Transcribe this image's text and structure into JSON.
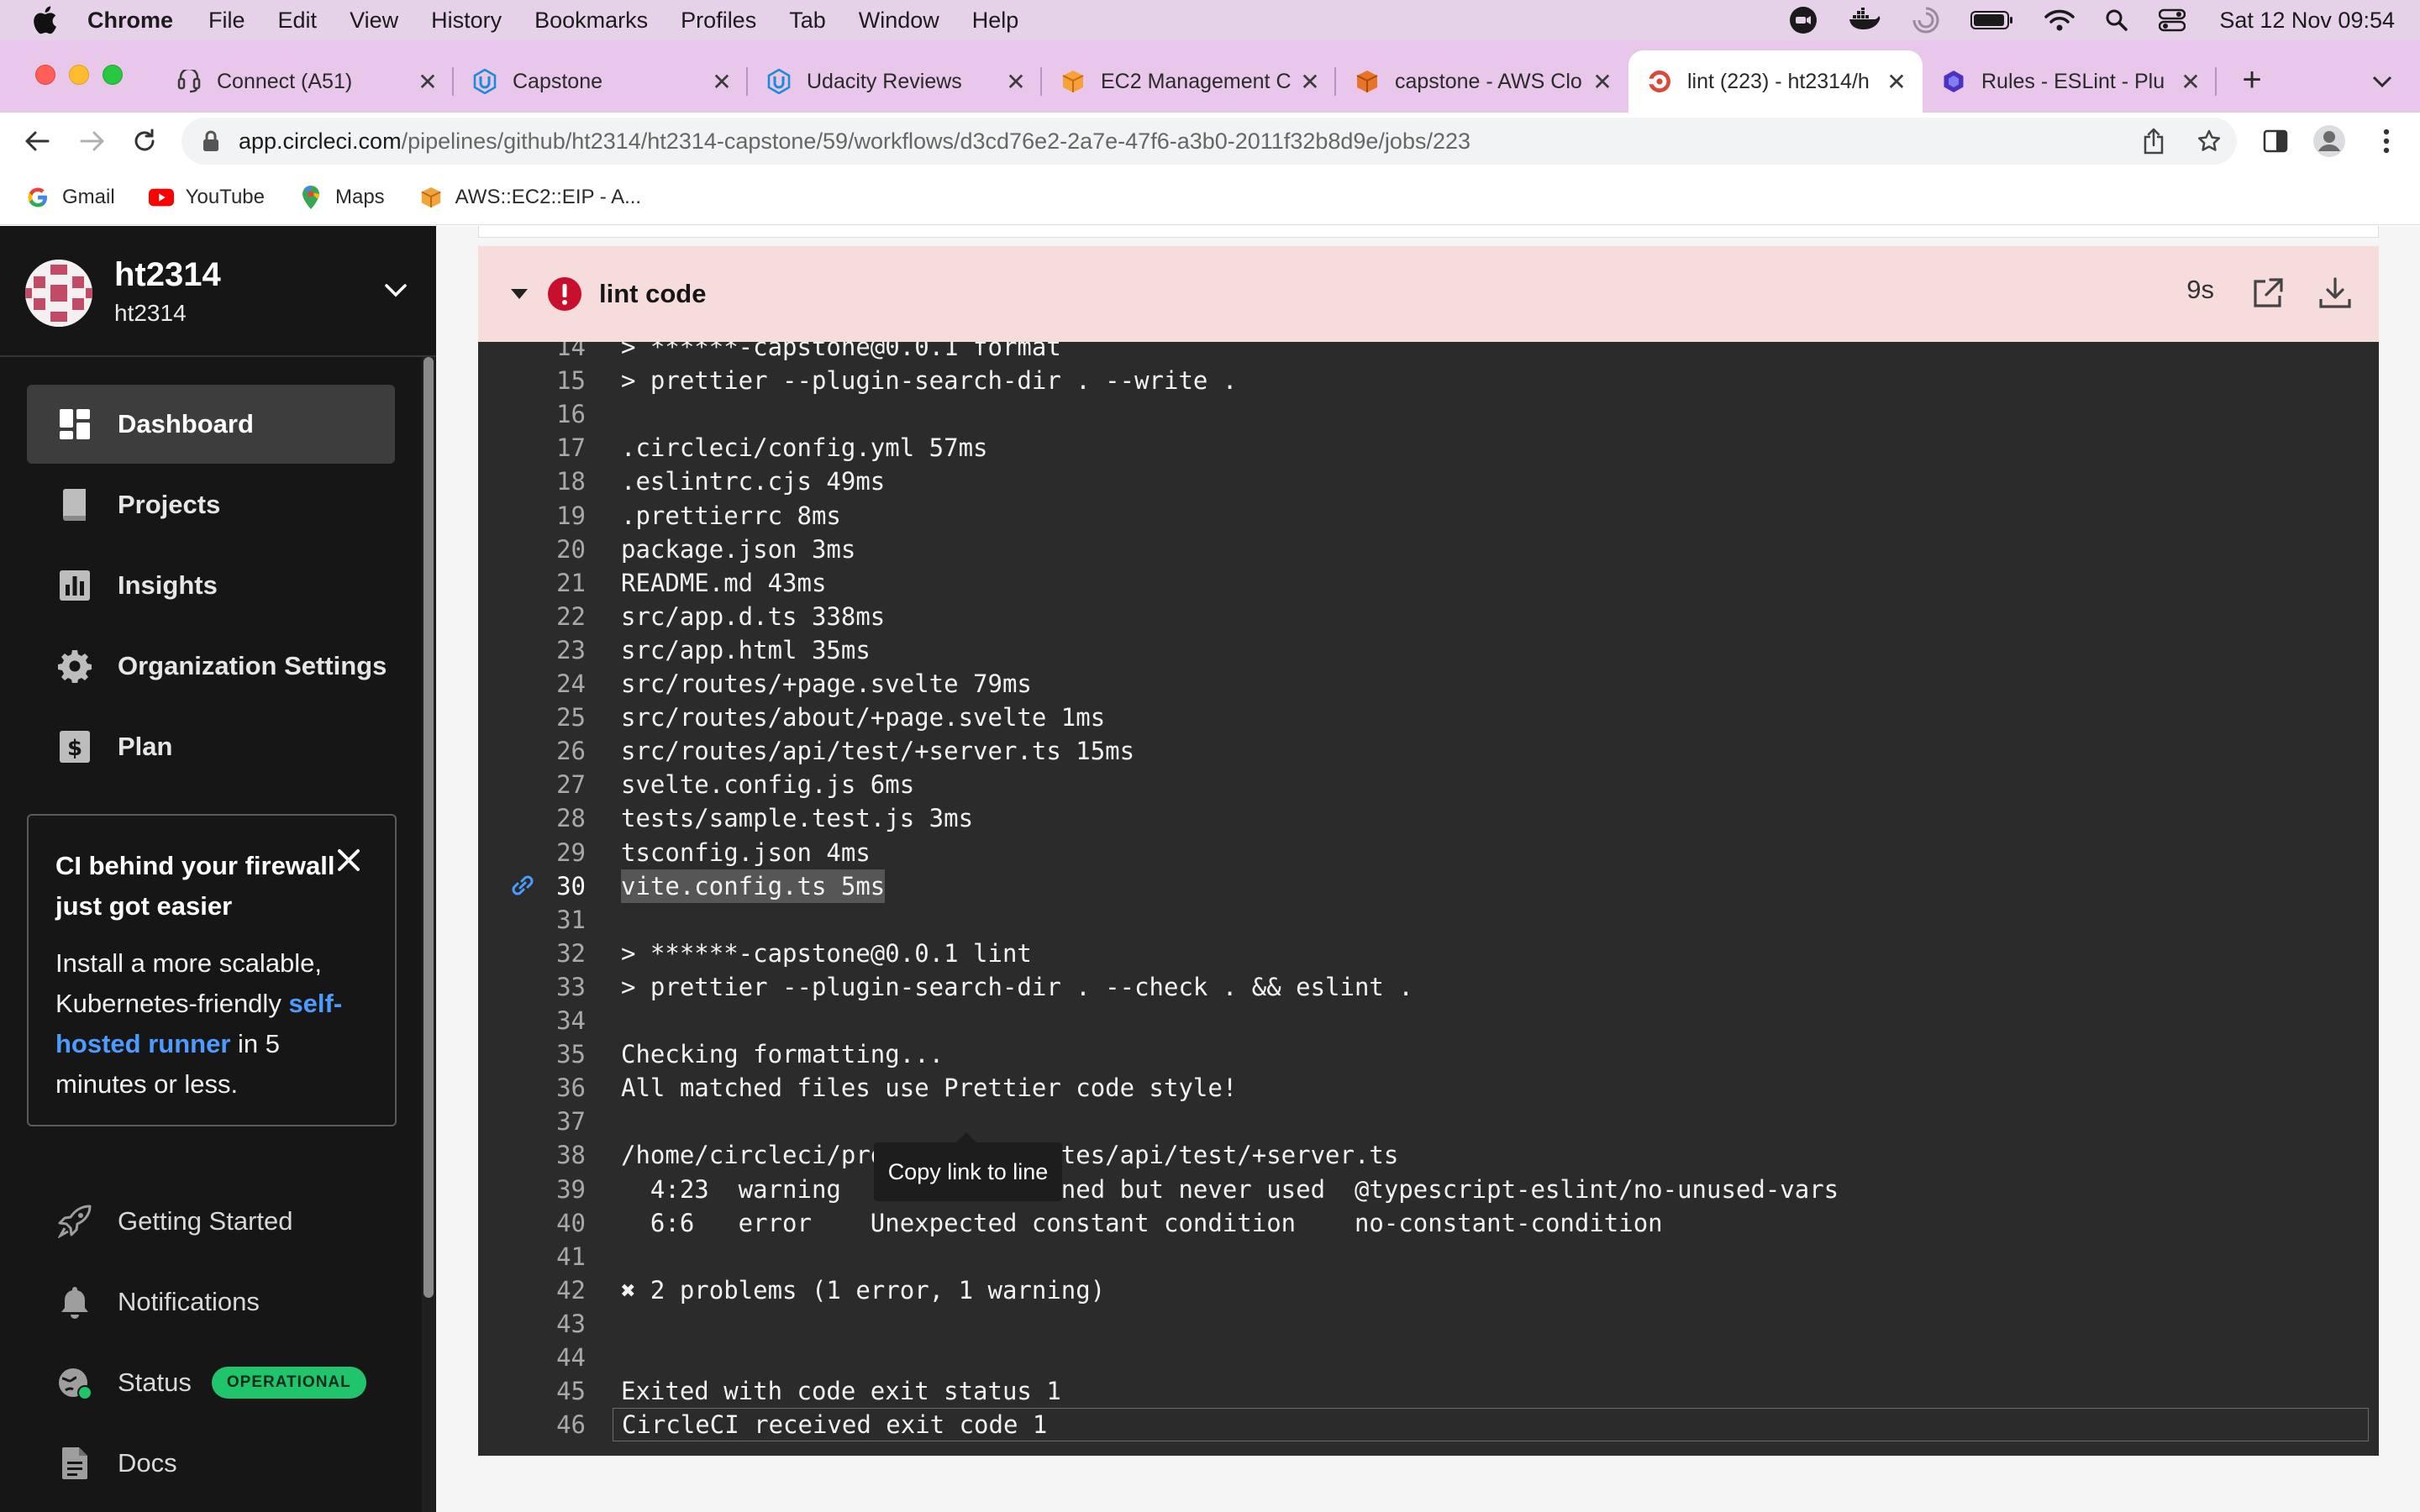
{
  "menubar": {
    "app_name": "Chrome",
    "items": [
      "File",
      "Edit",
      "View",
      "History",
      "Bookmarks",
      "Profiles",
      "Tab",
      "Window",
      "Help"
    ],
    "clock": "Sat 12 Nov  09:54"
  },
  "tabs": [
    {
      "title": "Connect (A51)",
      "icon": "aws-connect-icon"
    },
    {
      "title": "Capstone",
      "icon": "udacity-icon"
    },
    {
      "title": "Udacity Reviews",
      "icon": "udacity-icon"
    },
    {
      "title": "EC2 Management C",
      "icon": "aws-box-icon"
    },
    {
      "title": "capstone - AWS Clo",
      "icon": "aws-box-icon"
    },
    {
      "title": "lint (223) - ht2314/h",
      "icon": "circleci-icon",
      "active": true
    },
    {
      "title": "Rules - ESLint - Plu",
      "icon": "eslint-icon"
    }
  ],
  "address": {
    "host": "app.circleci.com",
    "path": "/pipelines/github/ht2314/ht2314-capstone/59/workflows/d3cd76e2-2a7e-47f6-a3b0-2011f32b8d9e/jobs/223"
  },
  "bookmarks": [
    {
      "label": "Gmail",
      "icon": "google-icon"
    },
    {
      "label": "YouTube",
      "icon": "youtube-icon"
    },
    {
      "label": "Maps",
      "icon": "maps-icon"
    },
    {
      "label": "AWS::EC2::EIP - A...",
      "icon": "aws-box-icon"
    }
  ],
  "sidebar": {
    "org_name": "ht2314",
    "org_sub": "ht2314",
    "nav": [
      {
        "label": "Dashboard",
        "icon": "dashboard-icon",
        "active": true
      },
      {
        "label": "Projects",
        "icon": "projects-icon"
      },
      {
        "label": "Insights",
        "icon": "insights-icon"
      },
      {
        "label": "Organization Settings",
        "icon": "gear-icon"
      },
      {
        "label": "Plan",
        "icon": "dollar-icon"
      }
    ],
    "promo": {
      "title": "CI behind your firewall just got easier",
      "body_before": "Install a more scalable, Kubernetes-friendly ",
      "link": "self-hosted runner",
      "body_after": " in 5 minutes or less."
    },
    "lower_nav": [
      {
        "label": "Getting Started",
        "icon": "rocket-icon"
      },
      {
        "label": "Notifications",
        "icon": "bell-icon"
      },
      {
        "label": "Status",
        "icon": "status-icon",
        "badge": "OPERATIONAL"
      },
      {
        "label": "Docs",
        "icon": "docs-icon"
      }
    ]
  },
  "step": {
    "name": "lint code",
    "duration": "9s",
    "status_color": "#d0021b"
  },
  "log_lines": [
    {
      "n": "14",
      "t": "> ******-capstone@0.0.1 format"
    },
    {
      "n": "15",
      "t": "> prettier --plugin-search-dir . --write ."
    },
    {
      "n": "16",
      "t": ""
    },
    {
      "n": "17",
      "t": ".circleci/config.yml 57ms"
    },
    {
      "n": "18",
      "t": ".eslintrc.cjs 49ms"
    },
    {
      "n": "19",
      "t": ".prettierrc 8ms"
    },
    {
      "n": "20",
      "t": "package.json 3ms"
    },
    {
      "n": "21",
      "t": "README.md 43ms"
    },
    {
      "n": "22",
      "t": "src/app.d.ts 338ms"
    },
    {
      "n": "23",
      "t": "src/app.html 35ms"
    },
    {
      "n": "24",
      "t": "src/routes/+page.svelte 79ms"
    },
    {
      "n": "25",
      "t": "src/routes/about/+page.svelte 1ms"
    },
    {
      "n": "26",
      "t": "src/routes/api/test/+server.ts 15ms"
    },
    {
      "n": "27",
      "t": "svelte.config.js 6ms"
    },
    {
      "n": "28",
      "t": "tests/sample.test.js 3ms"
    },
    {
      "n": "29",
      "t": "tsconfig.json 4ms"
    },
    {
      "n": "30",
      "t": "vite.config.ts 5ms",
      "selected": true
    },
    {
      "n": "31",
      "t": ""
    },
    {
      "n": "32",
      "t": "> ******-capstone@0.0.1 lint"
    },
    {
      "n": "33",
      "t": "> prettier --plugin-search-dir . --check . && eslint ."
    },
    {
      "n": "34",
      "t": ""
    },
    {
      "n": "35",
      "t": "Checking formatting..."
    },
    {
      "n": "36",
      "t": "All matched files use Prettier code style!"
    },
    {
      "n": "37",
      "t": ""
    },
    {
      "n": "38",
      "t": "/home/circleci/project/src/routes/api/test/+server.ts"
    },
    {
      "n": "39",
      "t": "  4:23  warning  'url' is defined but never used  @typescript-eslint/no-unused-vars"
    },
    {
      "n": "40",
      "t": "  6:6   error    Unexpected constant condition    no-constant-condition"
    },
    {
      "n": "41",
      "t": ""
    },
    {
      "n": "42",
      "t": "✖ 2 problems (1 error, 1 warning)"
    },
    {
      "n": "43",
      "t": ""
    },
    {
      "n": "44",
      "t": ""
    },
    {
      "n": "45",
      "t": "Exited with code exit status 1"
    },
    {
      "n": "46",
      "t": "CircleCI received exit code 1",
      "boxed": true
    }
  ],
  "tooltip": "Copy link to line",
  "colors": {
    "sidebar_bg": "#161616",
    "step_header_bg": "#f7dcdc",
    "log_bg": "#2b2b2b",
    "error_red": "#d0021b",
    "operational_green": "#1fc46b",
    "link_blue": "#4c9cff"
  }
}
